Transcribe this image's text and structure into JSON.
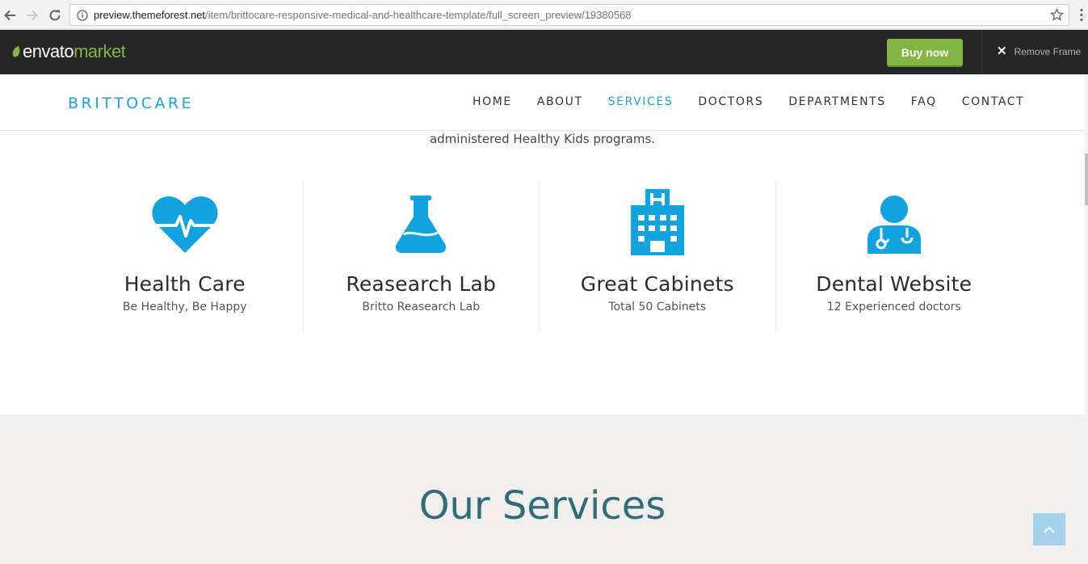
{
  "browser": {
    "url_host": "preview.themeforest.net",
    "url_path": "/item/brittocare-responsive-medical-and-healthcare-template/full_screen_preview/19380568",
    "icons": [
      "back-arrow-icon",
      "forward-arrow-icon",
      "reload-icon",
      "info-icon",
      "star-icon",
      "kebab-menu-icon"
    ]
  },
  "envato": {
    "logo_part1": "envato",
    "logo_part2": "market",
    "buy_label": "Buy now",
    "remove_frame_label": "Remove Frame",
    "brand_green": "#82b541"
  },
  "header": {
    "brand": "BRITTOCARE",
    "nav": [
      {
        "label": "HOME"
      },
      {
        "label": "ABOUT"
      },
      {
        "label": "SERVICES"
      },
      {
        "label": "DOCTORS"
      },
      {
        "label": "DEPARTMENTS"
      },
      {
        "label": "FAQ"
      },
      {
        "label": "CONTACT"
      }
    ],
    "active": "SERVICES",
    "accent": "#1aa3d9"
  },
  "intro": {
    "tail_text": "administered Healthy Kids programs."
  },
  "features": [
    {
      "icon": "heartbeat-icon",
      "title": "Health Care",
      "subtitle": "Be Healthy, Be Happy"
    },
    {
      "icon": "flask-icon",
      "title": "Reasearch Lab",
      "subtitle": "Britto Reasearch Lab"
    },
    {
      "icon": "hospital-icon",
      "title": "Great Cabinets",
      "subtitle": "Total 50 Cabinets"
    },
    {
      "icon": "doctor-icon",
      "title": "Dental Website",
      "subtitle": "12 Experienced doctors"
    }
  ],
  "services": {
    "title": "Our Services",
    "title_color": "#336b78"
  }
}
